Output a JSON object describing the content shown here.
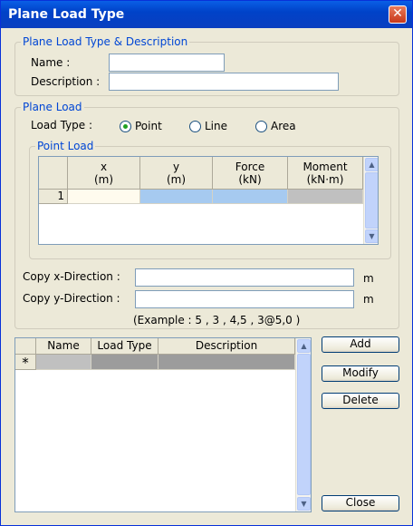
{
  "window": {
    "title": "Plane Load Type",
    "close_glyph": "✕"
  },
  "desc_group": {
    "label": "Plane Load Type & Description",
    "name_label": "Name :",
    "name_value": "",
    "description_label": "Description :",
    "description_value": ""
  },
  "plane_load": {
    "label": "Plane Load",
    "load_type_label": "Load Type :",
    "options": [
      {
        "label": "Point",
        "checked": true
      },
      {
        "label": "Line",
        "checked": false
      },
      {
        "label": "Area",
        "checked": false
      }
    ]
  },
  "point_load": {
    "label": "Point Load",
    "columns": [
      {
        "name": "x",
        "unit": "(m)"
      },
      {
        "name": "y",
        "unit": "(m)"
      },
      {
        "name": "Force",
        "unit": "(kN)"
      },
      {
        "name": "Moment",
        "unit": "(kN·m)"
      }
    ],
    "rows": [
      {
        "index": "1",
        "x": "",
        "y": "",
        "force": "",
        "moment": ""
      }
    ]
  },
  "copy": {
    "x_label": "Copy x-Direction :",
    "x_value": "",
    "x_unit": "m",
    "y_label": "Copy y-Direction :",
    "y_value": "",
    "y_unit": "m",
    "example": "(Example : 5 , 3 , 4,5 , 3@5,0 )"
  },
  "list": {
    "columns": [
      "Name",
      "Load Type",
      "Description"
    ],
    "new_row_marker": "*"
  },
  "buttons": {
    "add": "Add",
    "modify": "Modify",
    "delete": "Delete",
    "close": "Close"
  },
  "colors": {
    "title_bar": "#0a5fe6",
    "group_label": "#0046d5",
    "selected_cell": "#a6caf0",
    "disabled_cell": "#c0c0c0"
  }
}
